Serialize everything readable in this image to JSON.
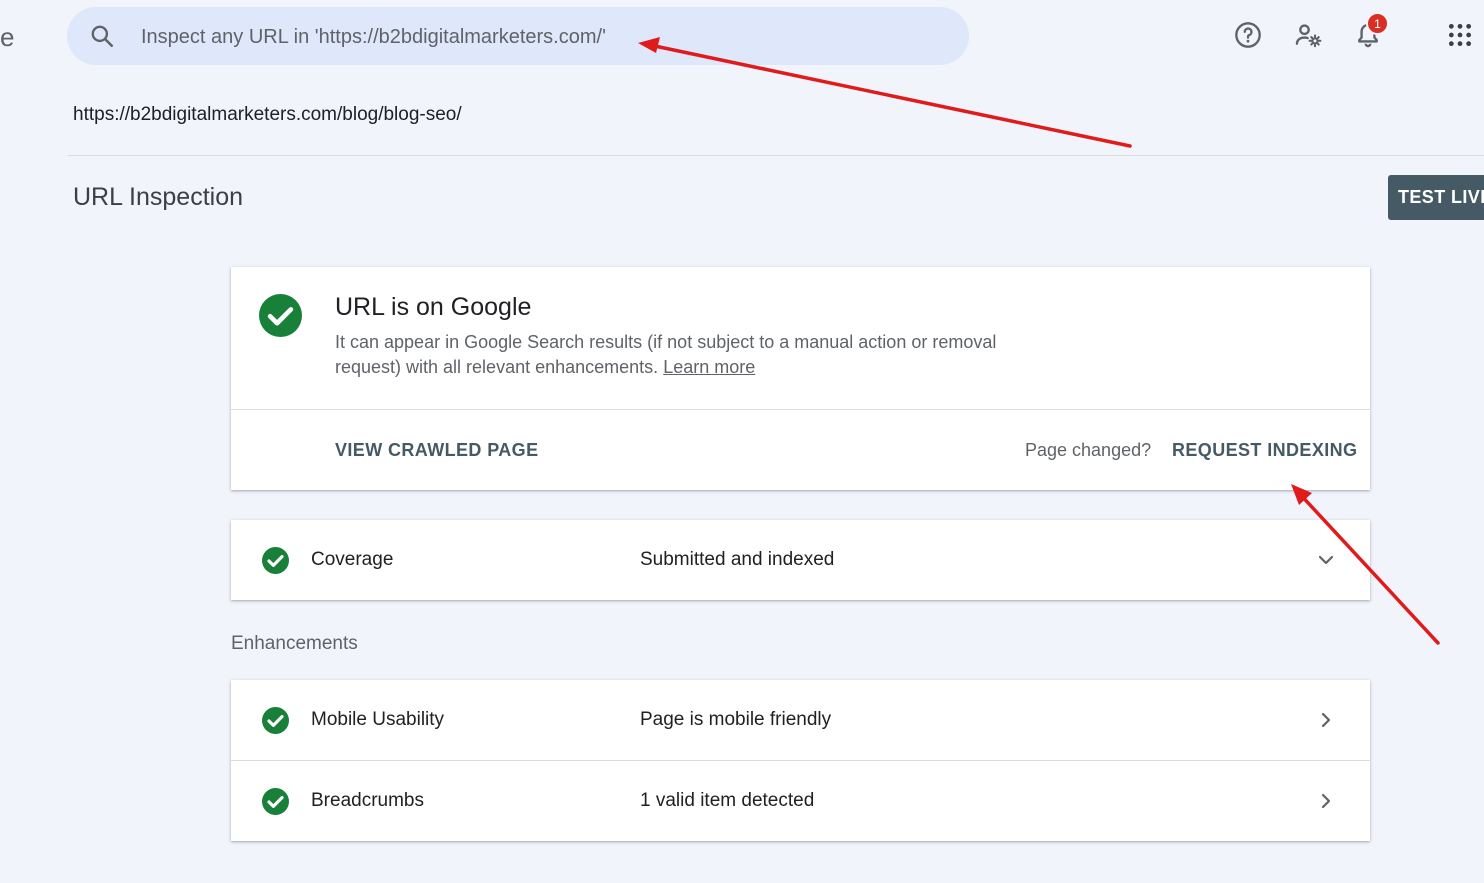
{
  "edge_text": "e",
  "search": {
    "placeholder": "Inspect any URL in 'https://b2bdigitalmarketers.com/'"
  },
  "header_icons": {
    "help": "help-circle-icon",
    "admin": "manage-accounts-icon",
    "notifications": "bell-icon",
    "notifications_count": "1",
    "apps": "apps-grid-icon"
  },
  "inspected_url": "https://b2bdigitalmarketers.com/blog/blog-seo/",
  "page_title": "URL Inspection",
  "test_live_label": "TEST LIVE",
  "status": {
    "title": "URL is on Google",
    "description": "It can appear in Google Search results (if not subject to a manual action or removal request) with all relevant enhancements.",
    "learn_more": "Learn more",
    "view_crawled": "VIEW CRAWLED PAGE",
    "page_changed": "Page changed?",
    "request_indexing": "REQUEST INDEXING"
  },
  "coverage": {
    "label": "Coverage",
    "value": "Submitted and indexed"
  },
  "enhancements": {
    "heading": "Enhancements",
    "items": [
      {
        "label": "Mobile Usability",
        "value": "Page is mobile friendly"
      },
      {
        "label": "Breadcrumbs",
        "value": "1 valid item detected"
      }
    ]
  },
  "colors": {
    "success_green": "#188038",
    "accent_button": "#455a64",
    "annotation_red": "#e01b1b",
    "search_bg": "#dfe7fa",
    "page_bg": "#f1f4fb"
  }
}
